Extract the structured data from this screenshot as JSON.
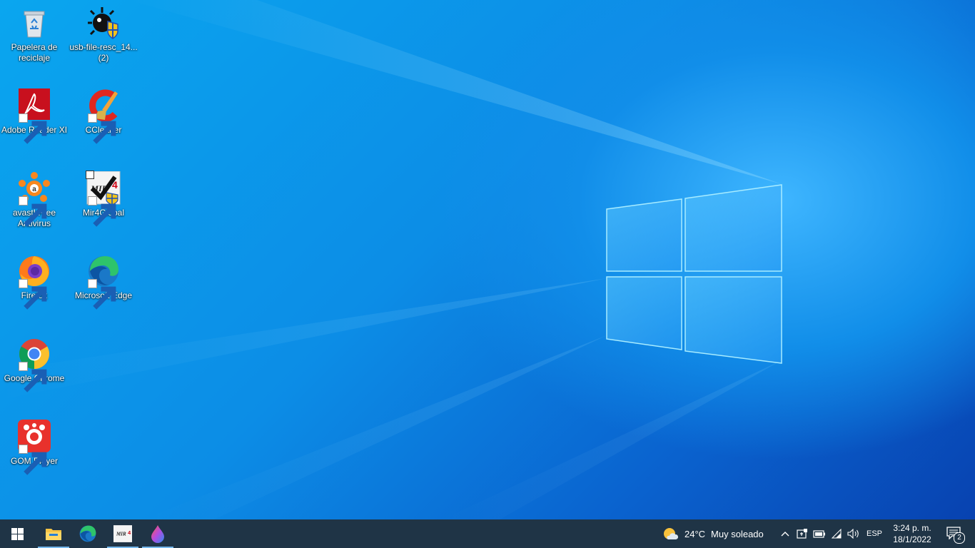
{
  "desktop": {
    "icons": [
      {
        "label": "Papelera de reciclaje",
        "icon": "recycle-bin-icon"
      },
      {
        "label": "usb-file-resc_14... (2)",
        "icon": "usb-file-rescue-icon"
      },
      {
        "label": "Adobe Reader XI",
        "icon": "adobe-reader-icon"
      },
      {
        "label": "CCleaner",
        "icon": "ccleaner-icon"
      },
      {
        "label": "avast! Free Antivirus",
        "icon": "avast-icon"
      },
      {
        "label": "Mir4Global",
        "icon": "mir4-icon"
      },
      {
        "label": "Firefox",
        "icon": "firefox-icon"
      },
      {
        "label": "Microsoft Edge",
        "icon": "edge-icon"
      },
      {
        "label": "Google Chrome",
        "icon": "chrome-icon"
      },
      {
        "label": "GOM Player",
        "icon": "gom-player-icon"
      }
    ]
  },
  "taskbar": {
    "pinned": [
      {
        "name": "file-explorer",
        "icon": "folder-icon",
        "active": true
      },
      {
        "name": "microsoft-edge",
        "icon": "edge-icon",
        "active": false
      },
      {
        "name": "mir4",
        "icon": "mir4-icon",
        "active": true
      },
      {
        "name": "paint-app",
        "icon": "paint-drop-icon",
        "active": true
      }
    ],
    "weather": {
      "temperature": "24°C",
      "condition": "Muy soleado"
    },
    "language": "ESP",
    "clock": {
      "time": "3:24 p. m.",
      "date": "18/1/2022"
    },
    "notifications_count": "2"
  },
  "colors": {
    "taskbar": "#1f3446",
    "accent": "#76b9ed",
    "desktop": "#0c8de6"
  }
}
